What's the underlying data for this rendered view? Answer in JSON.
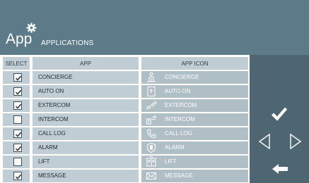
{
  "header": {
    "app_title": "App",
    "subtitle": "APPLICATIONS",
    "gear_icon": "gear-icon"
  },
  "table": {
    "columns": [
      "SELECT",
      "APP",
      "APP ICON"
    ],
    "rows": [
      {
        "selected": true,
        "app": "CONCIERGE",
        "icon": "concierge-icon",
        "icon_label": "CONCIERGE"
      },
      {
        "selected": true,
        "app": "AUTO ON",
        "icon": "auto-on-icon",
        "icon_label": "AUTO ON"
      },
      {
        "selected": true,
        "app": "EXTERCOM",
        "icon": "extercom-icon",
        "icon_label": "EXTERCOM"
      },
      {
        "selected": false,
        "app": "INTERCOM",
        "icon": "intercom-icon",
        "icon_label": "INTERCOM"
      },
      {
        "selected": true,
        "app": "CALL LOG",
        "icon": "call-log-icon",
        "icon_label": "CALL LOG"
      },
      {
        "selected": true,
        "app": "ALARM",
        "icon": "alarm-icon",
        "icon_label": "ALARM"
      },
      {
        "selected": false,
        "app": "LIFT",
        "icon": "lift-icon",
        "icon_label": "LIFT"
      },
      {
        "selected": true,
        "app": "MESSAGE",
        "icon": "message-icon",
        "icon_label": "MESSAGE"
      }
    ]
  },
  "side_panel": {
    "icons": [
      "checkmark-icon",
      "arrow-left-outline-icon",
      "arrow-right-outline-icon",
      "back-arrow-icon"
    ]
  },
  "colors": {
    "header_bg": "#5d7a89",
    "panel_bg": "#4e6672",
    "row_bg": "#c1cdd4",
    "icon_cell_bg": "#b0bec6"
  }
}
